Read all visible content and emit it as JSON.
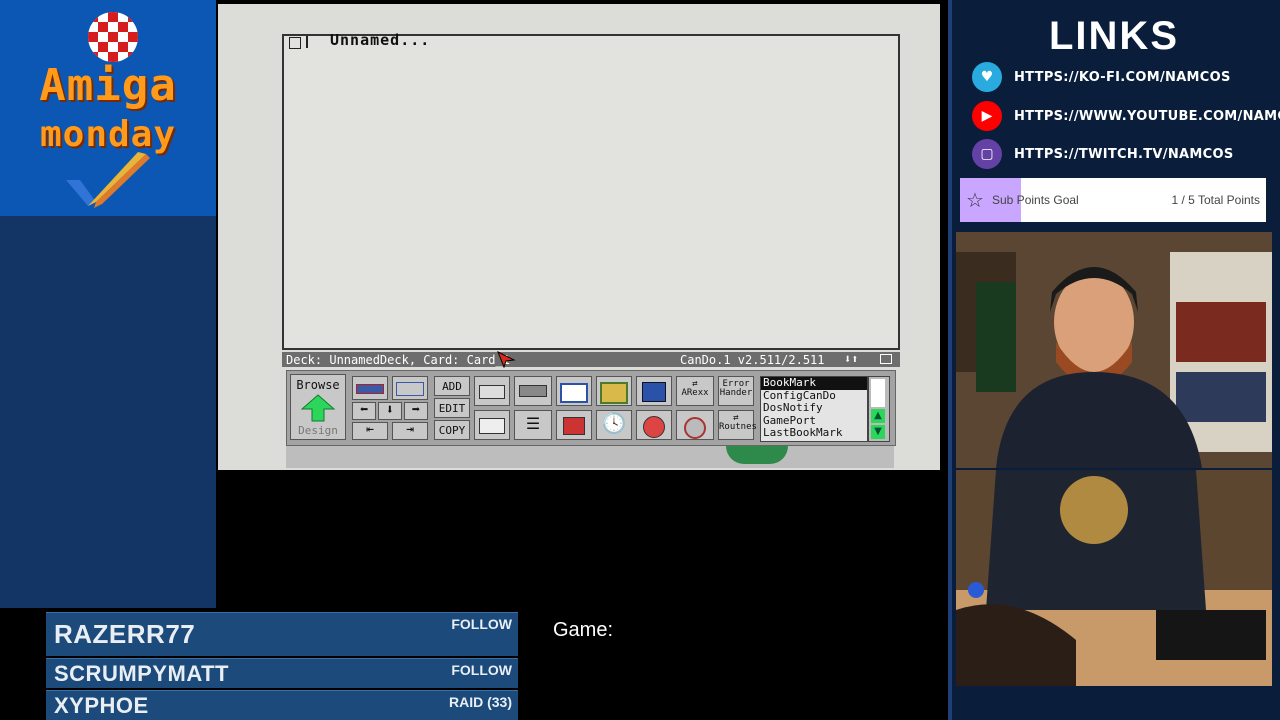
{
  "branding": {
    "line1": "Amiga",
    "line2": "monday"
  },
  "emulator": {
    "window_title": "Unnamed...",
    "status_left": "Deck: UnnamedDeck,  Card: Card_1",
    "status_right": "CanDo.1 v2.511/2.511",
    "toolbar": {
      "browse_label": "Browse",
      "design_label": "Design",
      "add_label": "ADD",
      "edit_label": "EDIT",
      "copy_label": "COPY",
      "error_label_1": "Error",
      "error_label_2": "Hander",
      "arexx_label": "ARexx",
      "routines_label": "Routnes"
    },
    "object_list": [
      "BookMark",
      "ConfigCanDo",
      "DosNotify",
      "GamePort",
      "LastBookMark"
    ]
  },
  "links_panel": {
    "title": "LINKS",
    "links": [
      {
        "text": "HTTPS://KO-FI.COM/NAMCOS",
        "icon": "kofi-cup-icon",
        "color": "#29abe0"
      },
      {
        "text": "HTTPS://WWW.YOUTUBE.COM/NAMCOS",
        "icon": "youtube-play-icon",
        "color": "#ff0000"
      },
      {
        "text": "HTTPS://TWITCH.TV/NAMCOS",
        "icon": "twitch-glitch-icon",
        "color": "#6441a5"
      }
    ],
    "goal": {
      "label": "Sub Points Goal",
      "progress_text": "1 / 5 Total Points",
      "progress": 0.2,
      "bar_color": "#c9a6ff"
    }
  },
  "ticker": [
    {
      "name": "RAZERR77",
      "action": "FOLLOW"
    },
    {
      "name": "SCRUMPYMATT",
      "action": "FOLLOW"
    },
    {
      "name": "XYPHOE",
      "action": "RAID (33)"
    }
  ],
  "game": {
    "label": "Game:"
  },
  "colors": {
    "accent_blue": "#0b57b3",
    "panel_navy": "#0a1e3c",
    "logo_orange": "#ff9a1a"
  }
}
